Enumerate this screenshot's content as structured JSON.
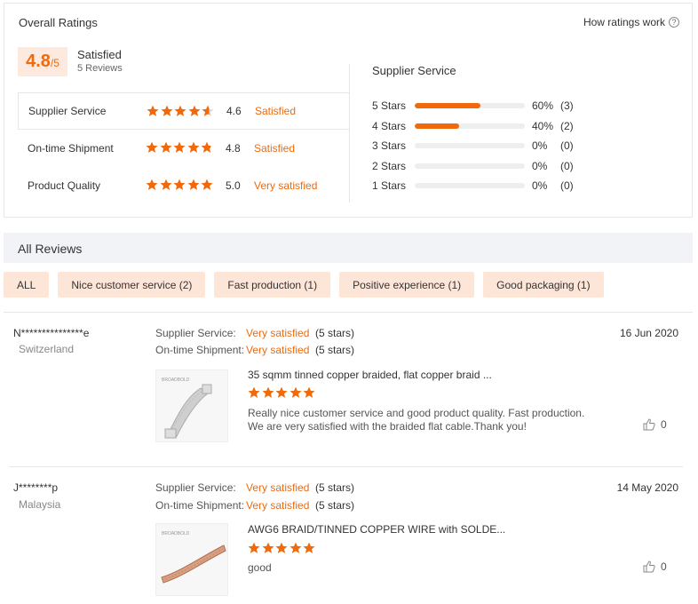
{
  "overall": {
    "title": "Overall Ratings",
    "how_link": "How ratings work",
    "score": "4.8",
    "score_suffix": "/5",
    "summary": "Satisfied",
    "reviews_count": "5 Reviews"
  },
  "metrics": [
    {
      "label": "Supplier Service",
      "value": "4.6",
      "status": "Satisfied",
      "stars": 4.6
    },
    {
      "label": "On-time Shipment",
      "value": "4.8",
      "status": "Satisfied",
      "stars": 4.8
    },
    {
      "label": "Product Quality",
      "value": "5.0",
      "status": "Very satisfied",
      "stars": 5
    }
  ],
  "distribution": {
    "title": "Supplier Service",
    "rows": [
      {
        "label": "5 Stars",
        "pct_text": "60%",
        "count": "(3)",
        "fraction": 0.6
      },
      {
        "label": "4 Stars",
        "pct_text": "40%",
        "count": "(2)",
        "fraction": 0.4
      },
      {
        "label": "3 Stars",
        "pct_text": "0%",
        "count": "(0)",
        "fraction": 0
      },
      {
        "label": "2 Stars",
        "pct_text": "0%",
        "count": "(0)",
        "fraction": 0
      },
      {
        "label": "1 Stars",
        "pct_text": "0%",
        "count": "(0)",
        "fraction": 0
      }
    ]
  },
  "all_reviews": {
    "title": "All Reviews",
    "filters": [
      "ALL",
      "Nice customer service (2)",
      "Fast production (1)",
      "Positive experience (1)",
      "Good packaging (1)"
    ]
  },
  "reviews": [
    {
      "name": "N***************e",
      "country": "Switzerland",
      "date": "16 Jun 2020",
      "attr1_label": "Supplier Service:",
      "attr1_val": "Very satisfied",
      "attr1_stars": "(5 stars)",
      "attr2_label": "On-time Shipment:",
      "attr2_val": "Very satisfied",
      "attr2_stars": "(5 stars)",
      "product": "35 sqmm tinned copper braided, flat copper braid ...",
      "rating": 5,
      "text": "Really nice customer service and good product quality. Fast production. We are very satisfied with the braided flat cable.Thank you!",
      "likes": "0"
    },
    {
      "name": "J********p",
      "country": "Malaysia",
      "date": "14 May 2020",
      "attr1_label": "Supplier Service:",
      "attr1_val": "Very satisfied",
      "attr1_stars": "(5 stars)",
      "attr2_label": "On-time Shipment:",
      "attr2_val": "Very satisfied",
      "attr2_stars": "(5 stars)",
      "product": "AWG6 BRAID/TINNED COPPER WIRE with SOLDE...",
      "rating": 5,
      "text": "good",
      "likes": "0"
    }
  ],
  "colors": {
    "accent": "#f06a0b",
    "accent_bg": "#fde6d8",
    "star_empty": "#dddddd"
  }
}
